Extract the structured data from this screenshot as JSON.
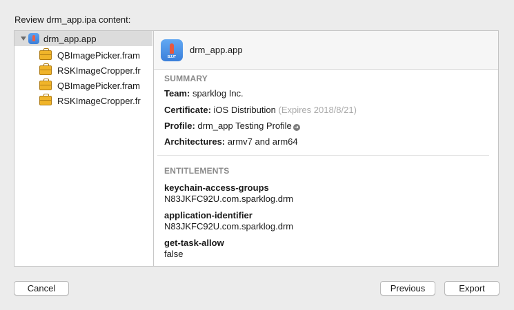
{
  "review_title": "Review drm_app.ipa content:",
  "tree": {
    "root": {
      "label": "drm_app.app",
      "icon": "app-icon"
    },
    "items": [
      {
        "label": "QBImagePicker.fram",
        "icon": "framework-icon"
      },
      {
        "label": "RSKImageCropper.fr",
        "icon": "framework-icon"
      },
      {
        "label": "QBImagePicker.fram",
        "icon": "framework-icon"
      },
      {
        "label": "RSKImageCropper.fr",
        "icon": "framework-icon"
      }
    ]
  },
  "detail": {
    "title": "drm_app.app",
    "icon_caption": "BJJT",
    "summary": {
      "heading": "SUMMARY",
      "team_label": "Team:",
      "team_value": "sparklog Inc.",
      "certificate_label": "Certificate:",
      "certificate_value": "iOS Distribution",
      "certificate_expiry": "(Expires 2018/8/21)",
      "profile_label": "Profile:",
      "profile_value": "drm_app Testing Profile",
      "architectures_label": "Architectures:",
      "architectures_value": "armv7 and arm64"
    },
    "entitlements": {
      "heading": "ENTITLEMENTS",
      "items": [
        {
          "key": "keychain-access-groups",
          "value": "N83JKFC92U.com.sparklog.drm"
        },
        {
          "key": "application-identifier",
          "value": "N83JKFC92U.com.sparklog.drm"
        },
        {
          "key": "get-task-allow",
          "value": "false"
        }
      ]
    }
  },
  "buttons": {
    "cancel": "Cancel",
    "previous": "Previous",
    "export": "Export"
  }
}
